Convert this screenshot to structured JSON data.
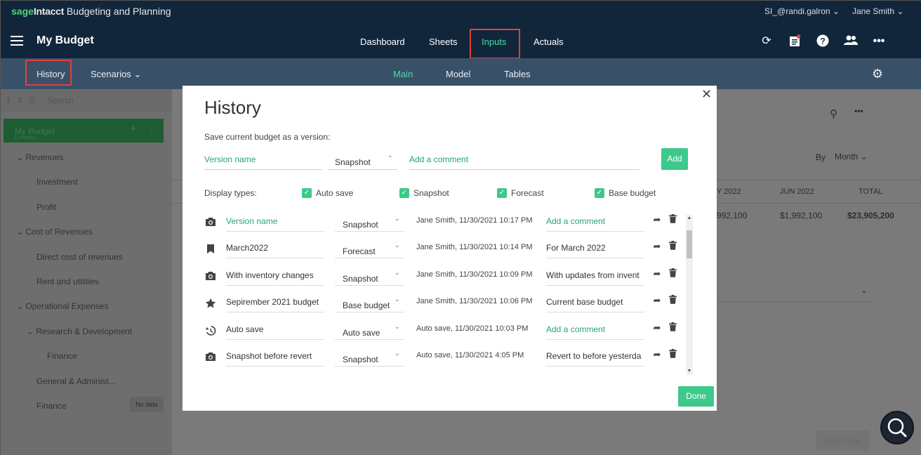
{
  "topbar": {
    "brand_sage": "sage",
    "brand_intacct": "Intacct",
    "brand_product": "Budgeting and Planning",
    "user_account": "SI_@randi.galron",
    "user_name": "Jane Smith",
    "app_title": "My Budget",
    "nav": [
      "Dashboard",
      "Sheets",
      "Inputs",
      "Actuals"
    ],
    "active_nav": "Inputs"
  },
  "subbar": {
    "history": "History",
    "scenarios": "Scenarios",
    "tabs": [
      "Main",
      "Model",
      "Tables"
    ],
    "active_tab": "Main"
  },
  "left": {
    "search_placeholder": "Search",
    "my_budget": "My Budget",
    "my_budget_sub": "Company",
    "tree": [
      "Revenues",
      "Investment",
      "Profit",
      "Cost of Revenues",
      "Direct cost of revenues",
      "Rent and utilities",
      "Operational Expenses",
      "Research & Development",
      "Finance",
      "General & Administ...",
      "Finance"
    ],
    "no_data_badge": "No data"
  },
  "right_bg": {
    "by_label": "By",
    "period": "Month",
    "col_may": "Y 2022",
    "col_jun": "JUN 2022",
    "col_total": "TOTAL",
    "val_may": "992,100",
    "val_jun": "$1,992,100",
    "val_total": "$23,905,200",
    "save_now": "Save Now"
  },
  "modal": {
    "title": "History",
    "save_label": "Save current budget as a version:",
    "version_name_placeholder": "Version name",
    "type_value": "Snapshot",
    "comment_placeholder": "Add a comment",
    "add_button": "Add",
    "display_types_label": "Display types:",
    "display_types": [
      "Auto save",
      "Snapshot",
      "Forecast",
      "Base budget"
    ],
    "rows": [
      {
        "icon": "camera-icon",
        "name": "Version name",
        "type": "Snapshot",
        "when": "Jane Smith, 11/30/2021 10:17 PM",
        "comment": "Add a comment"
      },
      {
        "icon": "bookmark-icon",
        "name": "March2022",
        "type": "Forecast",
        "when": "Jane Smith, 11/30/2021 10:14 PM",
        "comment": "For March 2022"
      },
      {
        "icon": "camera-icon",
        "name": "With inventory changes",
        "type": "Snapshot",
        "when": "Jane Smith, 11/30/2021 10:09 PM",
        "comment": "With updates from invent"
      },
      {
        "icon": "star-icon",
        "name": "Sepirember 2021 budget",
        "type": "Base budget",
        "when": "Jane Smith, 11/30/2021 10:06 PM",
        "comment": "Current base budget"
      },
      {
        "icon": "history-icon",
        "name": "Auto save",
        "type": "Auto save",
        "when": "Auto save, 11/30/2021 10:03 PM",
        "comment": "Add a comment"
      },
      {
        "icon": "camera-icon",
        "name": "Snapshot before revert",
        "type": "Snapshot",
        "when": "Auto save, 11/30/2021 4:05 PM",
        "comment": "Revert to before yesterda"
      }
    ],
    "done_button": "Done"
  }
}
